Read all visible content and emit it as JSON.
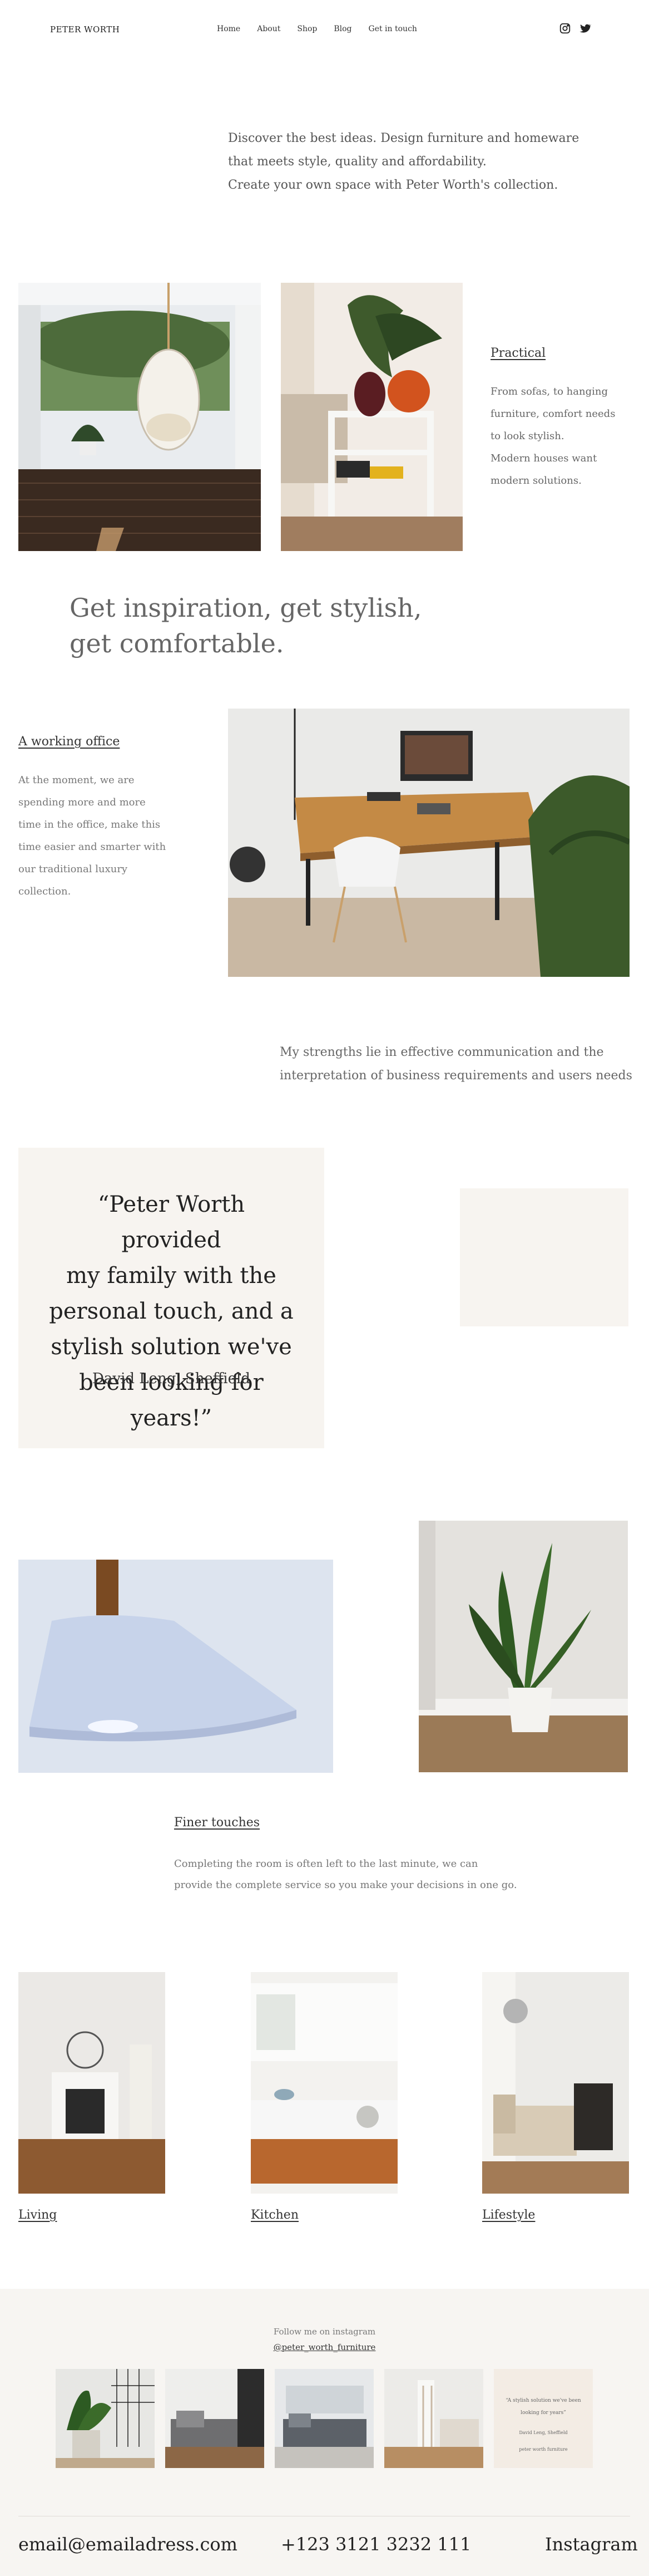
{
  "header": {
    "logo": "PETER WORTH",
    "nav": [
      "Home",
      "About",
      "Shop",
      "Blog",
      "Get in touch"
    ],
    "social_icons": [
      "instagram-icon",
      "twitter-icon"
    ]
  },
  "intro": {
    "lines": [
      "Discover the best ideas. Design furniture and homeware",
      "that meets style, quality and affordability.",
      "Create your own space with Peter Worth's collection."
    ]
  },
  "practical": {
    "title": "Practical",
    "lines": [
      "From sofas, to hanging",
      "furniture, comfort needs",
      "to look stylish.",
      "Modern houses want",
      "modern solutions."
    ]
  },
  "headline": {
    "lines": [
      "Get inspiration, get stylish,",
      "get comfortable."
    ]
  },
  "office": {
    "title": "A working office",
    "lines": [
      "At the moment, we are",
      "spending more and more",
      "time in the office, make this",
      "time easier and smarter with",
      "our traditional luxury",
      "collection."
    ]
  },
  "strengths": {
    "lines": [
      "My strengths lie in effective communication and the",
      "interpretation of business requirements and users needs"
    ]
  },
  "testimonial": {
    "lines": [
      "“Peter Worth provided",
      "my family with the",
      "personal touch, and a",
      "stylish solution we've",
      "been looking for years!”"
    ],
    "author": "David Leng, Sheffield"
  },
  "finer": {
    "title": "Finer touches",
    "lines": [
      "Completing the room is often left to the last minute, we can",
      "provide the complete service so you make your decisions in one go."
    ]
  },
  "rooms": [
    "Living",
    "Kitchen",
    "Lifestyle"
  ],
  "instagram": {
    "follow": "Follow me on instagram",
    "handle": "@peter_worth_furniture",
    "quote_thumb": {
      "text": "“A stylish solution we've been looking for years”",
      "author": "David Leng, Sheffield",
      "caption": "peter worth furniture"
    }
  },
  "footer": {
    "email": "email@emailadress.com",
    "phone": "+123 3121 3232 111",
    "instagram": "Instagram"
  },
  "colors": {
    "beige": "#f7f4f0",
    "text": "#4a4a4a"
  }
}
